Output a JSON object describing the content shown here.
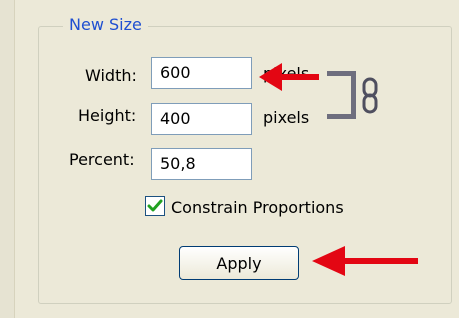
{
  "group": {
    "title": "New Size"
  },
  "fields": {
    "width": {
      "label": "Width:",
      "value": "600",
      "unit": "pixels"
    },
    "height": {
      "label": "Height:",
      "value": "400",
      "unit": "pixels"
    },
    "percent": {
      "label": "Percent:",
      "value": "50,8"
    }
  },
  "constrain": {
    "label": "Constrain Proportions",
    "checked": true
  },
  "apply": {
    "label": "Apply"
  },
  "colors": {
    "background": "#ece9d8",
    "title": "#1f4fd1",
    "arrow": "#e30613",
    "check": "#21a121"
  },
  "icons": {
    "chain": "chain-link-icon",
    "arrow": "red-arrow-icon",
    "check": "checkmark-icon"
  }
}
